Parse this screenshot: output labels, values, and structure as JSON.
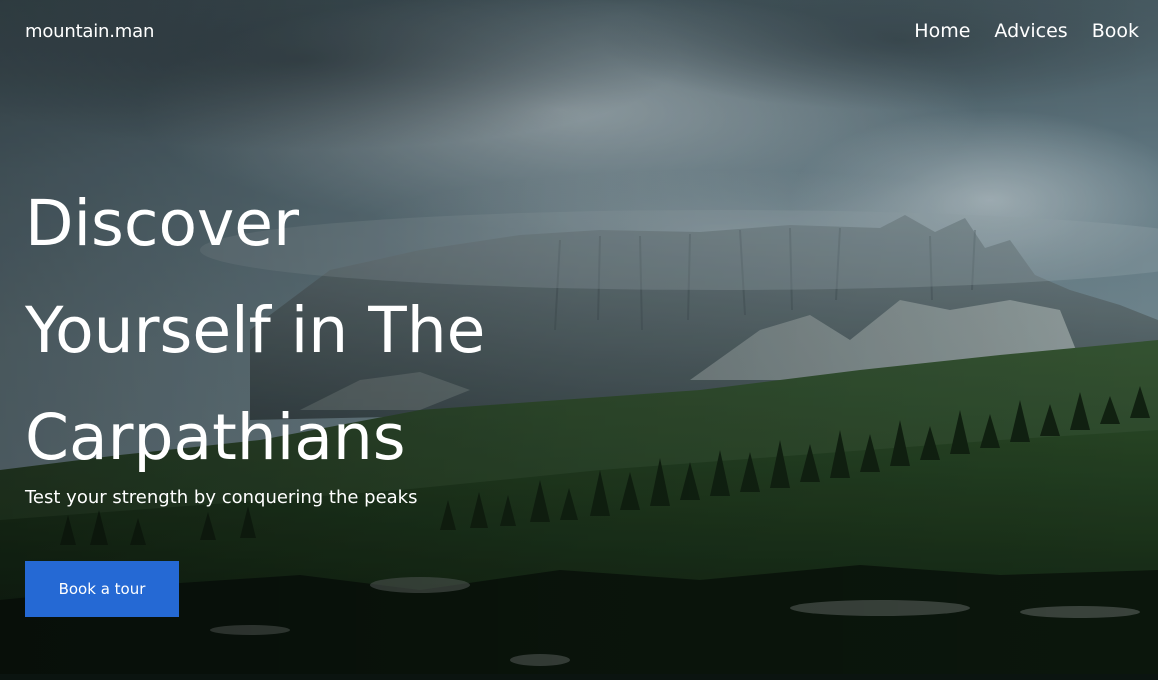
{
  "header": {
    "logo": "mountain.man",
    "nav": [
      {
        "label": "Home"
      },
      {
        "label": "Advices"
      },
      {
        "label": "Book"
      }
    ]
  },
  "hero": {
    "headline_lines": [
      "Discover",
      "Yourself in The",
      "Carpathians"
    ],
    "subtitle": "Test your strength by conquering the peaks",
    "cta_label": "Book a tour"
  },
  "colors": {
    "accent": "#2569d4",
    "text": "#ffffff",
    "sky": "#6f8791",
    "meadow": "#1f3a1c"
  }
}
